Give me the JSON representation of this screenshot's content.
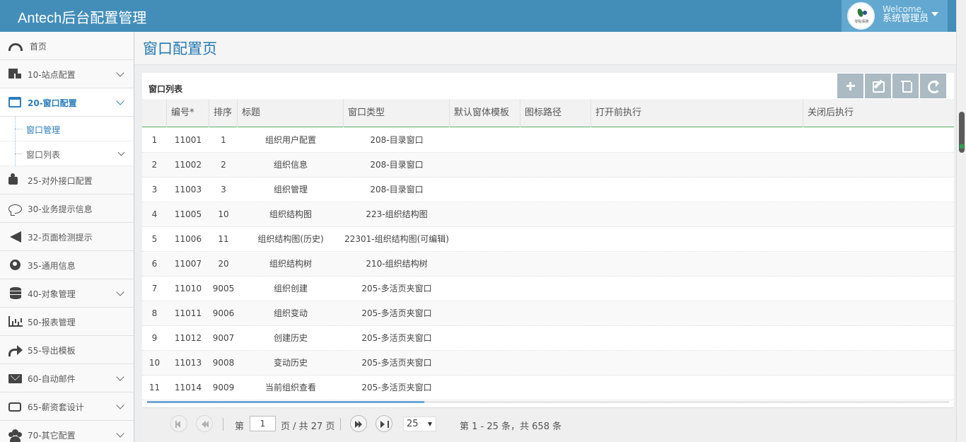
{
  "header": {
    "app_title": "Antech后台配置管理",
    "welcome_label": "Welcome,",
    "user_name": "系统管理员",
    "logo_text": "零點事務"
  },
  "sidebar": {
    "items": [
      {
        "label": "首页",
        "icon": "dashboard-icon"
      },
      {
        "label": "10-站点配置",
        "icon": "cubes-icon"
      },
      {
        "label": "20-窗口配置",
        "icon": "window-icon",
        "active": true
      },
      {
        "label": "25-对外接口配置",
        "icon": "puzzle-icon"
      },
      {
        "label": "30-业务提示信息",
        "icon": "comment-icon"
      },
      {
        "label": "32-页面检测提示",
        "icon": "bullhorn-icon"
      },
      {
        "label": "35-通用信息",
        "icon": "globe-icon"
      },
      {
        "label": "40-对象管理",
        "icon": "database-icon"
      },
      {
        "label": "50-报表管理",
        "icon": "bar-chart-icon"
      },
      {
        "label": "55-导出模板",
        "icon": "share-icon"
      },
      {
        "label": "60-自动邮件",
        "icon": "envelope-icon"
      },
      {
        "label": "65-薪资套设计",
        "icon": "inbox-icon"
      },
      {
        "label": "70-其它配置",
        "icon": "users-icon"
      }
    ],
    "sub_items": [
      {
        "label": "窗口管理"
      },
      {
        "label": "窗口列表"
      }
    ]
  },
  "page": {
    "title": "窗口配置页"
  },
  "grid": {
    "caption": "窗口列表",
    "toolbar": [
      "add-icon",
      "edit-icon",
      "delete-icon",
      "refresh-icon"
    ],
    "columns": [
      "编号*",
      "排序",
      "标题",
      "窗口类型",
      "默认窗体模板",
      "图标路径",
      "打开前执行",
      "关闭后执行"
    ],
    "rows": [
      {
        "n": "1",
        "id": "11001",
        "sort": "1",
        "title": "组织用户配置",
        "type": "208-目录窗口"
      },
      {
        "n": "2",
        "id": "11002",
        "sort": "2",
        "title": "组织信息",
        "type": "208-目录窗口"
      },
      {
        "n": "3",
        "id": "11003",
        "sort": "3",
        "title": "组织管理",
        "type": "208-目录窗口"
      },
      {
        "n": "4",
        "id": "11005",
        "sort": "10",
        "title": "组织结构图",
        "type": "223-组织结构图"
      },
      {
        "n": "5",
        "id": "11006",
        "sort": "11",
        "title": "组织结构图(历史)",
        "type": "22301-组织结构图(可编辑)"
      },
      {
        "n": "6",
        "id": "11007",
        "sort": "20",
        "title": "组织结构树",
        "type": "210-组织结构树"
      },
      {
        "n": "7",
        "id": "11010",
        "sort": "9005",
        "title": "组织创建",
        "type": "205-多活页夹窗口"
      },
      {
        "n": "8",
        "id": "11011",
        "sort": "9006",
        "title": "组织变动",
        "type": "205-多活页夹窗口"
      },
      {
        "n": "9",
        "id": "11012",
        "sort": "9007",
        "title": "创建历史",
        "type": "205-多活页夹窗口"
      },
      {
        "n": "10",
        "id": "11013",
        "sort": "9008",
        "title": "变动历史",
        "type": "205-多活页夹窗口"
      },
      {
        "n": "11",
        "id": "11014",
        "sort": "9009",
        "title": "当前组织查看",
        "type": "205-多活页夹窗口"
      }
    ]
  },
  "pager": {
    "page_prefix": "第",
    "current_page": "1",
    "page_suffix": "页 / 共 27 页",
    "page_size": "25",
    "summary": "第 1 - 25 条，共 658 条"
  }
}
